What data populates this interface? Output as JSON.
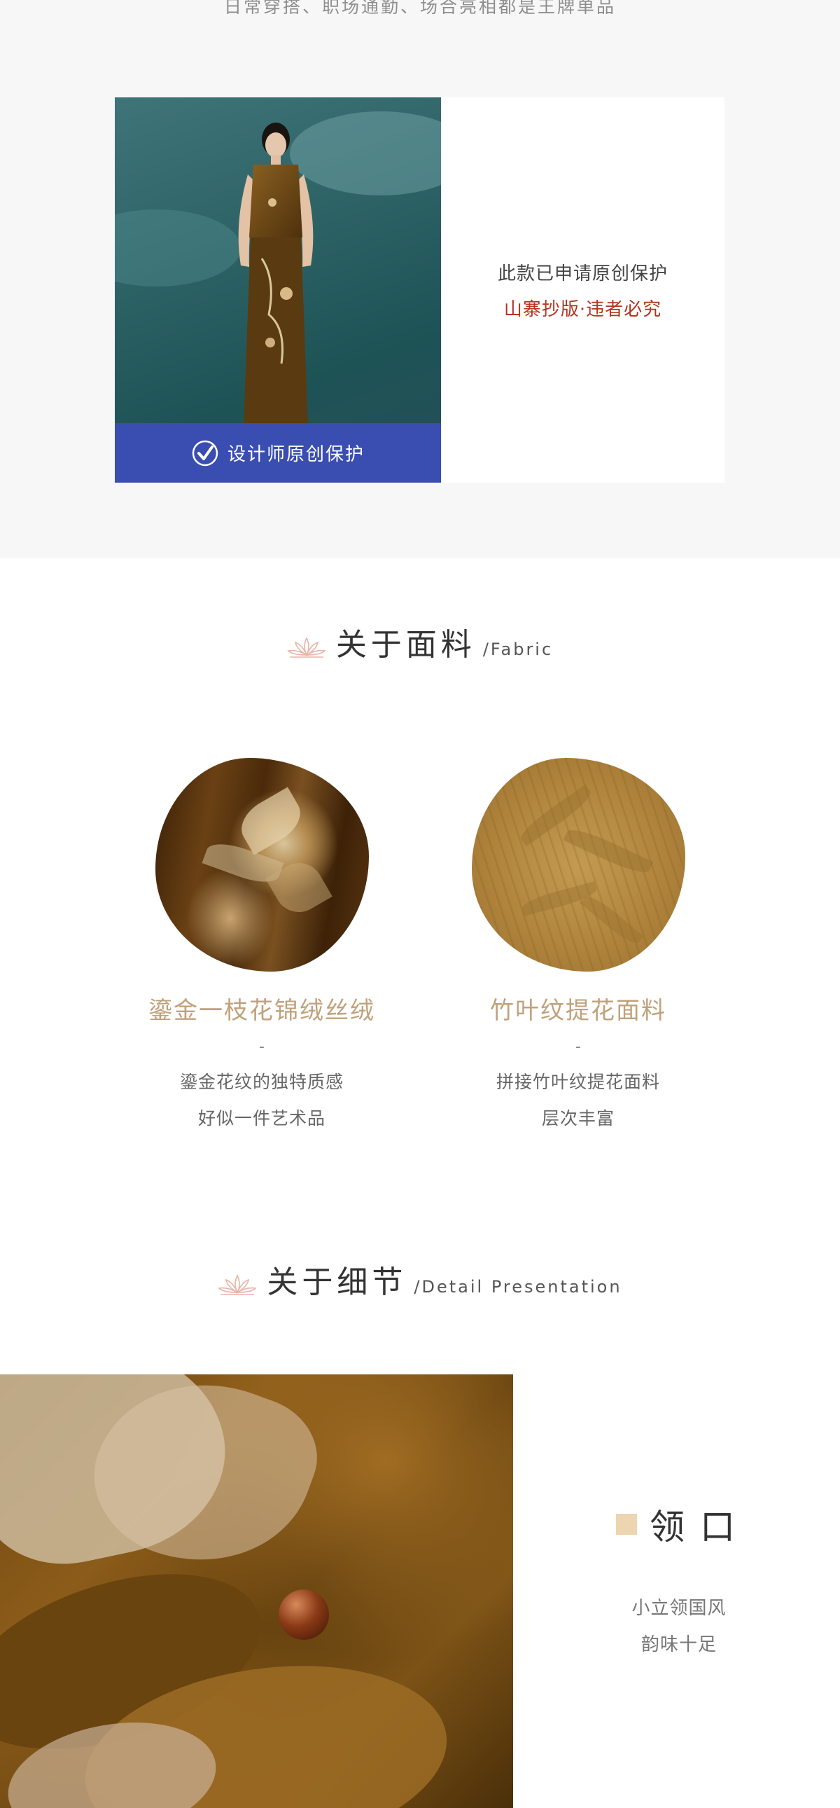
{
  "top_caption": "日常穿搭、职场通勤、场合亮相都是王牌单品",
  "protection": {
    "banner_text": "设计师原创保护",
    "line1": "此款已申请原创保护",
    "line2": "山寨抄版·违者必究",
    "accent_color": "#b5331f",
    "banner_color": "#3a4db0"
  },
  "fabric_section": {
    "title_cn": "关于面料",
    "title_en": "/Fabric",
    "items": [
      {
        "name": "鎏金一枝花锦绒丝绒",
        "dash": "-",
        "desc_lines": [
          "鎏金花纹的独特质感",
          "好似一件艺术品"
        ]
      },
      {
        "name": "竹叶纹提花面料",
        "dash": "-",
        "desc_lines": [
          "拼接竹叶纹提花面料",
          "层次丰富"
        ]
      }
    ],
    "name_color": "#c0a17b"
  },
  "detail_section": {
    "title_cn": "关于细节",
    "title_en": "/Detail Presentation",
    "label": "领口",
    "desc_lines": [
      "小立领国风",
      "韵味十足"
    ],
    "square_color": "#ecd5b0"
  },
  "icons": [
    "check-circle-icon",
    "lotus-icon"
  ]
}
